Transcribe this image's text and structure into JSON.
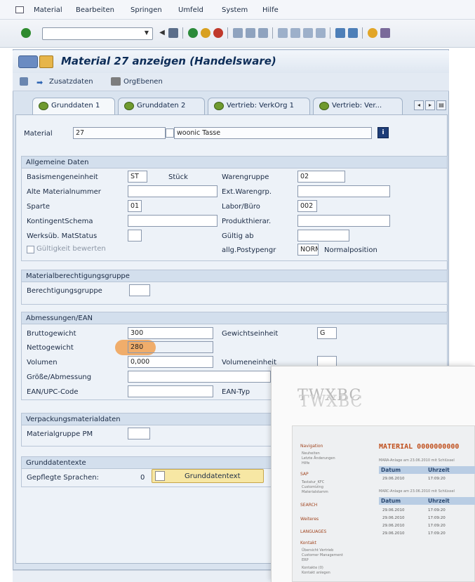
{
  "menu": [
    "Material",
    "Bearbeiten",
    "Springen",
    "Umfeld",
    "System",
    "Hilfe"
  ],
  "toolbar": {
    "command_value": ""
  },
  "window": {
    "title": "Material 27 anzeigen (Handelsware)"
  },
  "app_toolbar": {
    "zusatzdaten": "Zusatzdaten",
    "orgebenen": "OrgEbenen"
  },
  "tabs": [
    "Grunddaten 1",
    "Grunddaten 2",
    "Vertrieb: VerkOrg 1",
    "Vertrieb: Ver..."
  ],
  "header": {
    "material_label": "Material",
    "material_value": "27",
    "description": "woonic Tasse"
  },
  "allgemeine": {
    "title": "Allgemeine Daten",
    "basismenge_label": "Basismengeneinheit",
    "basismenge_value": "ST",
    "basismenge_text": "Stück",
    "warengruppe_label": "Warengruppe",
    "warengruppe_value": "02",
    "alte_label": "Alte Materialnummer",
    "alte_value": "",
    "extwaren_label": "Ext.Warengrp.",
    "extwaren_value": "",
    "sparte_label": "Sparte",
    "sparte_value": "01",
    "labor_label": "Labor/Büro",
    "labor_value": "002",
    "kontingent_label": "KontingentSchema",
    "kontingent_value": "",
    "produkthier_label": "Produkthierar.",
    "produkthier_value": "",
    "werksueb_label": "Werksüb. MatStatus",
    "werksueb_value": "",
    "gueltig_label": "Gültig ab",
    "gueltig_value": "",
    "gueltigkeit_label": "Gültigkeit bewerten",
    "postyp_label": "allg.Postypengr",
    "postyp_value": "NORM",
    "postyp_text": "Normalposition"
  },
  "berechtigung": {
    "title": "Materialberechtigungsgruppe",
    "label": "Berechtigungsgruppe",
    "value": ""
  },
  "abmessungen": {
    "title": "Abmessungen/EAN",
    "brutto_label": "Bruttogewicht",
    "brutto_value": "300",
    "gewichtseinheit_label": "Gewichtseinheit",
    "gewichtseinheit_value": "G",
    "netto_label": "Nettogewicht",
    "netto_value": "280",
    "volumen_label": "Volumen",
    "volumen_value": "0,000",
    "volumeneinheit_label": "Volumeneinheit",
    "volumeneinheit_value": "",
    "groesse_label": "Größe/Abmessung",
    "groesse_value": "",
    "ean_label": "EAN/UPC-Code",
    "ean_value": "",
    "eantyp_label": "EAN-Typ"
  },
  "verpackung": {
    "title": "Verpackungsmaterialdaten",
    "label": "Materialgruppe PM",
    "value": ""
  },
  "grunddatentexte": {
    "title": "Grunddatentexte",
    "label": "Gepflegte Sprachen:",
    "count": "0",
    "button": "Grunddatentext"
  },
  "overlay": {
    "logo": "TWXBC",
    "heading": "MATERIAL 0000000000",
    "side_titles": [
      "Navigation",
      "SAP",
      "SEARCH",
      "Weiteres",
      "LANGUAGES",
      "Kontakt"
    ],
    "side_items": [
      "Neuheiten",
      "Letzte Änderungen",
      "Hilfe",
      "Tastatur_KFC",
      "Customizing",
      "Materialstamm",
      "Übersicht Vertrieb",
      "Customer Management",
      "ERP",
      "Kontakte (0)",
      "Kontakt anlegen"
    ],
    "note1": "MARA-Anlage am 23.06.2010 mit Schlüssel",
    "note2": "MARC-Anlage am 23.06.2010 mit Schlüssel",
    "col_datum": "Datum",
    "col_uhrzeit": "Uhrzeit",
    "rows1": [
      [
        "29.06.2010",
        "17:09:20"
      ]
    ],
    "rows2": [
      [
        "29.06.2010",
        "17:09:20"
      ],
      [
        "29.06.2010",
        "17:09:20"
      ],
      [
        "29.06.2010",
        "17:09:20"
      ],
      [
        "29.06.2010",
        "17:09:20"
      ]
    ]
  }
}
